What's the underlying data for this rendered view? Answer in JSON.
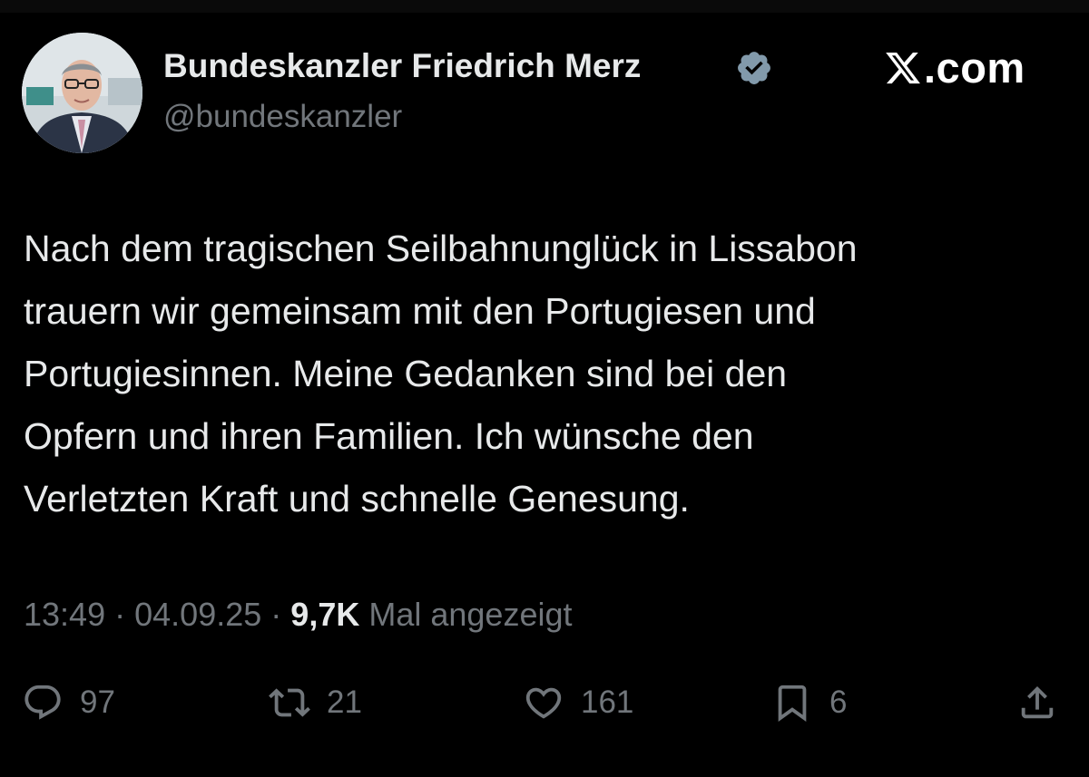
{
  "author": {
    "name": "Bundeskanzler Friedrich Merz",
    "handle": "@bundeskanzler",
    "verified": true,
    "avatar_icon": "profile-photo"
  },
  "brand": {
    "suffix": ".com",
    "icon": "x-logo-icon"
  },
  "tweet": {
    "lines": [
      "Nach dem tragischen Seilbahnunglück in Lissabon",
      "trauern wir gemeinsam mit den Portugiesen und",
      "Portugiesinnen. Meine Gedanken sind bei den",
      "Opfern und ihren Familien. Ich wünsche den",
      "Verletzten Kraft und schnelle Genesung."
    ]
  },
  "meta": {
    "time": "13:49",
    "separator": "·",
    "date": "04.09.25",
    "views_count": "9,7K",
    "views_label": "Mal angezeigt"
  },
  "actions": {
    "replies": "97",
    "reposts": "21",
    "likes": "161",
    "bookmarks": "6"
  },
  "colors": {
    "background": "#000000",
    "text": "#e7e9ea",
    "muted": "#71767b",
    "verified_badge": "#829aab"
  }
}
